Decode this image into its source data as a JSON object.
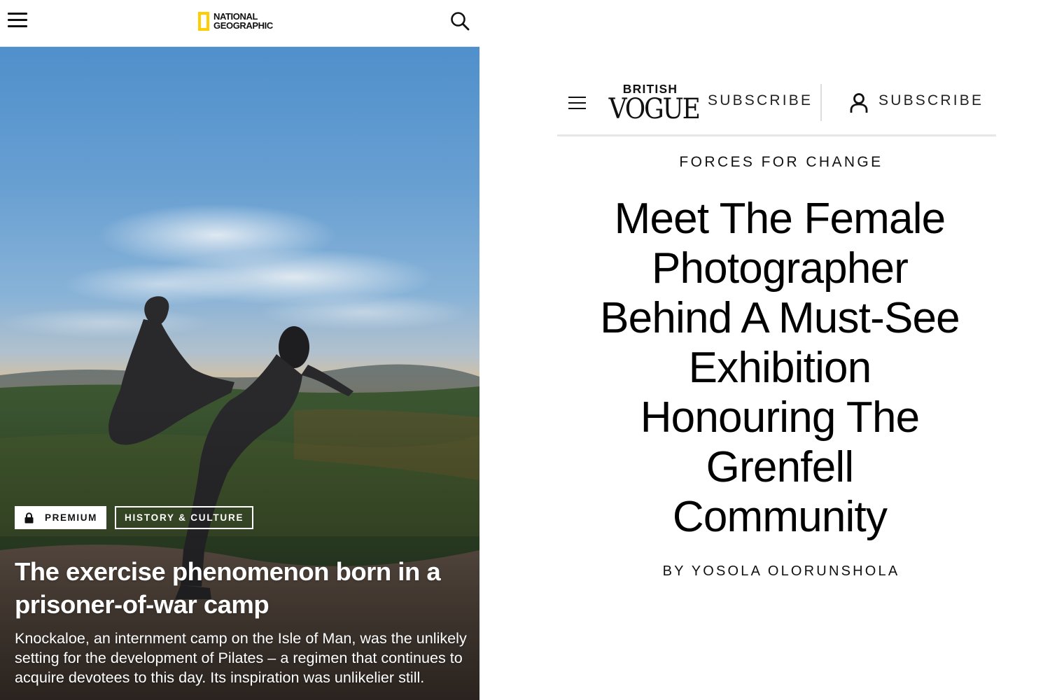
{
  "natgeo": {
    "header": {
      "logo_line1": "NATIONAL",
      "logo_line2": "GEOGRAPHIC",
      "brand_color": "#ffce00",
      "menu_icon": "hamburger-menu-icon",
      "search_icon": "search-icon"
    },
    "badges": {
      "premium_label": "PREMIUM",
      "premium_icon": "lock-icon",
      "category_label": "HISTORY & CULTURE"
    },
    "article": {
      "title": "The exercise phenomenon born in a prisoner-of-war camp",
      "dek": "Knockaloe, an internment camp on the Isle of Man, was the unlikely setting for the development of Pilates – a regimen that continues to acquire devotees to this day. Its inspiration was unlikelier still."
    }
  },
  "vogue": {
    "header": {
      "logo_top": "BRITISH",
      "logo_main": "VOGUE",
      "subscribe_label": "SUBSCRIBE",
      "account_subscribe_label": "SUBSCRIBE",
      "menu_icon": "hamburger-menu-icon",
      "account_icon": "user-account-icon"
    },
    "article": {
      "rubric": "FORCES FOR CHANGE",
      "headline_lines": [
        "Meet The Female",
        "Photographer",
        "Behind A Must-See",
        "Exhibition",
        "Honouring The",
        "Grenfell",
        "Community"
      ],
      "byline_prefix": "BY",
      "author": "YOSOLA OLORUNSHOLA"
    }
  }
}
